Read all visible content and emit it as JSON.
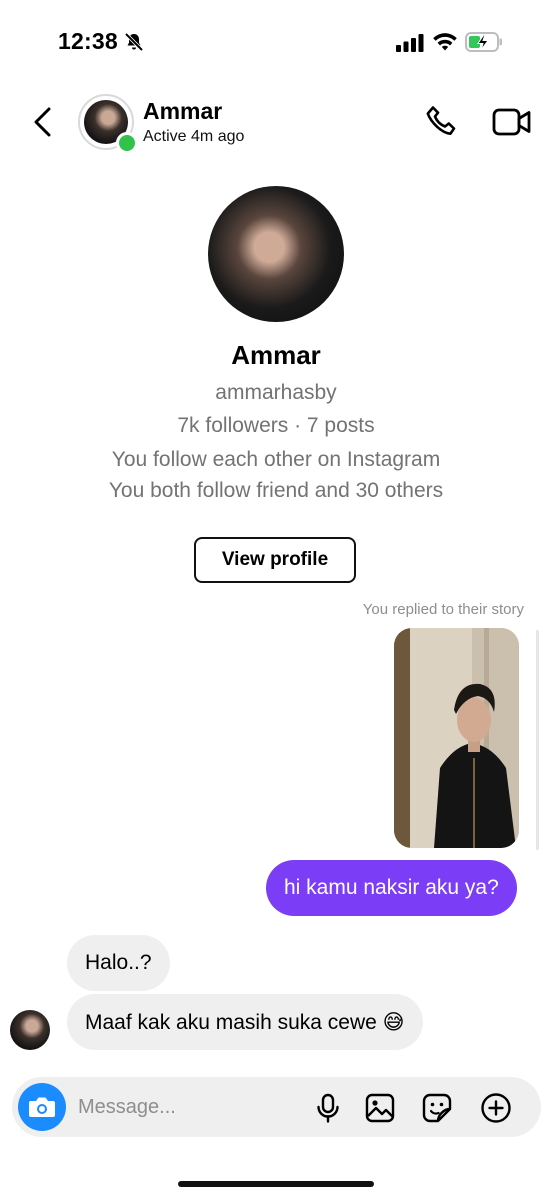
{
  "status_bar": {
    "time": "12:38",
    "icons": [
      "bell-slash-icon",
      "signal-icon",
      "wifi-icon",
      "battery-charging-icon"
    ]
  },
  "header": {
    "name": "Ammar",
    "status": "Active 4m ago",
    "icons": [
      "back-arrow-icon",
      "phone-icon",
      "video-camera-icon"
    ]
  },
  "profile": {
    "name": "Ammar",
    "username": "ammarhasby",
    "stats": "7k followers · 7 posts",
    "mutual_line1": "You follow each other on Instagram",
    "mutual_line2": "You both follow friend and 30 others",
    "view_profile_label": "View profile"
  },
  "conversation": {
    "story_note": "You replied to their story",
    "messages": [
      {
        "from": "me",
        "text": "hi kamu naksir aku ya?"
      },
      {
        "from": "them",
        "text": "Halo..?"
      },
      {
        "from": "them",
        "text": "Maaf kak aku masih suka cewe 😅"
      }
    ]
  },
  "composer": {
    "placeholder": "Message...",
    "icons": [
      "camera-icon",
      "microphone-icon",
      "gallery-icon",
      "sticker-icon",
      "plus-icon"
    ]
  },
  "colors": {
    "accent_bubble": "#7b3df5",
    "camera_button": "#1a8cff",
    "online": "#30c24a"
  }
}
